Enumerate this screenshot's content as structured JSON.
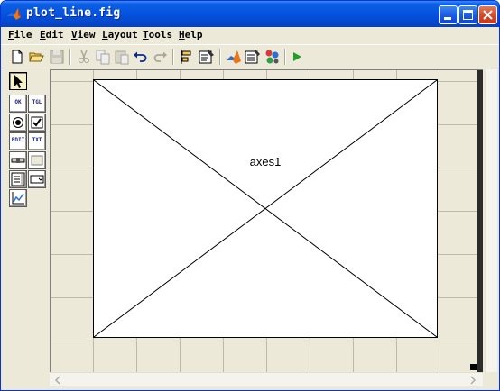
{
  "window": {
    "title": "plot_line.fig"
  },
  "menubar": [
    {
      "key": "F",
      "rest": "ile"
    },
    {
      "key": "E",
      "rest": "dit"
    },
    {
      "key": "V",
      "rest": "iew"
    },
    {
      "key": "L",
      "rest": "ayout"
    },
    {
      "key": "T",
      "rest": "ools"
    },
    {
      "key": "H",
      "rest": "elp"
    }
  ],
  "toolbar": [
    {
      "icon": "new-file-icon",
      "enabled": true
    },
    {
      "icon": "open-folder-icon",
      "enabled": true
    },
    {
      "icon": "save-icon",
      "enabled": false
    },
    {
      "icon": "cut-icon",
      "enabled": false
    },
    {
      "icon": "copy-icon",
      "enabled": false
    },
    {
      "icon": "paste-icon",
      "enabled": false
    },
    {
      "icon": "undo-icon",
      "enabled": true
    },
    {
      "icon": "redo-icon",
      "enabled": false
    },
    {
      "icon": "align-objects-icon",
      "enabled": true
    },
    {
      "icon": "menu-editor-icon",
      "enabled": true
    },
    {
      "icon": "mfile-editor-icon",
      "enabled": true
    },
    {
      "icon": "property-inspector-icon",
      "enabled": true
    },
    {
      "icon": "object-browser-icon",
      "enabled": true
    },
    {
      "icon": "run-icon",
      "enabled": true
    }
  ],
  "palette": {
    "select_tool": "select-arrow-icon",
    "push_button": "OK",
    "toggle_button": "TGL",
    "radio_button": "radio-button-icon",
    "checkbox": "checkbox-icon",
    "edit_text": "EDIT",
    "static_text": "TXT",
    "slider": "slider-icon",
    "frame": "frame-icon",
    "listbox": "listbox-icon",
    "popup_menu": "popup-menu-icon",
    "axes": "axes-icon"
  },
  "canvas": {
    "axes_label": "axes1",
    "grid_color": "#bdb9a8",
    "background_color": "#ece9d8"
  },
  "colors": {
    "titlebar_blue": "#0655e0",
    "close_red": "#d2492a",
    "run_green": "#1f9e2a"
  }
}
